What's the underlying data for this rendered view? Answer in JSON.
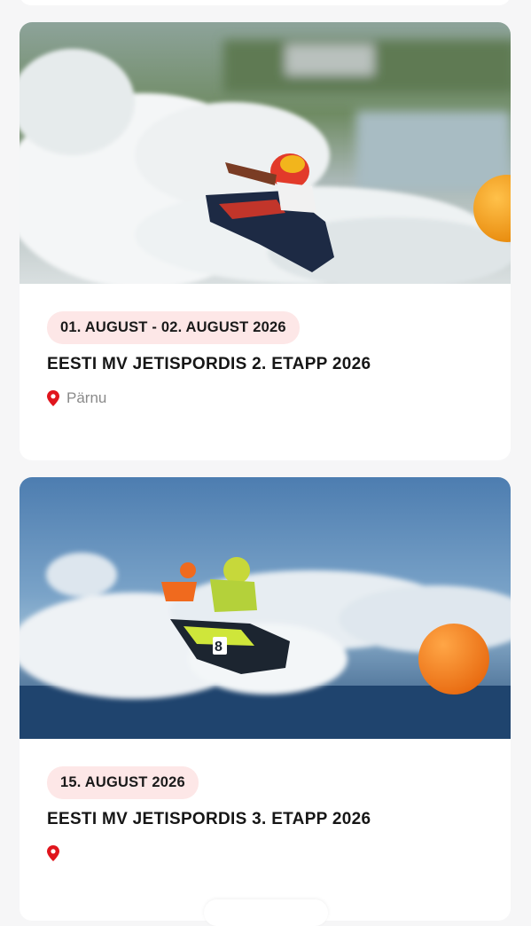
{
  "events": [
    {
      "date": "01. AUGUST - 02. AUGUST 2026",
      "title": "EESTI MV JETISPORDIS 2. ETAPP 2026",
      "location": "Pärnu",
      "image": "jetski-racer-red-helmet-spray"
    },
    {
      "date": "15. AUGUST 2026",
      "title": "EESTI MV JETISPORDIS 3. ETAPP 2026",
      "location": "",
      "image": "jetski-racer-green-number-8-orange-buoy"
    }
  ],
  "icons": {
    "location": "map-pin-icon"
  },
  "colors": {
    "badge_bg": "#fde7e7",
    "pin": "#e0151d",
    "card_bg": "#ffffff",
    "page_bg": "#f6f6f7"
  }
}
